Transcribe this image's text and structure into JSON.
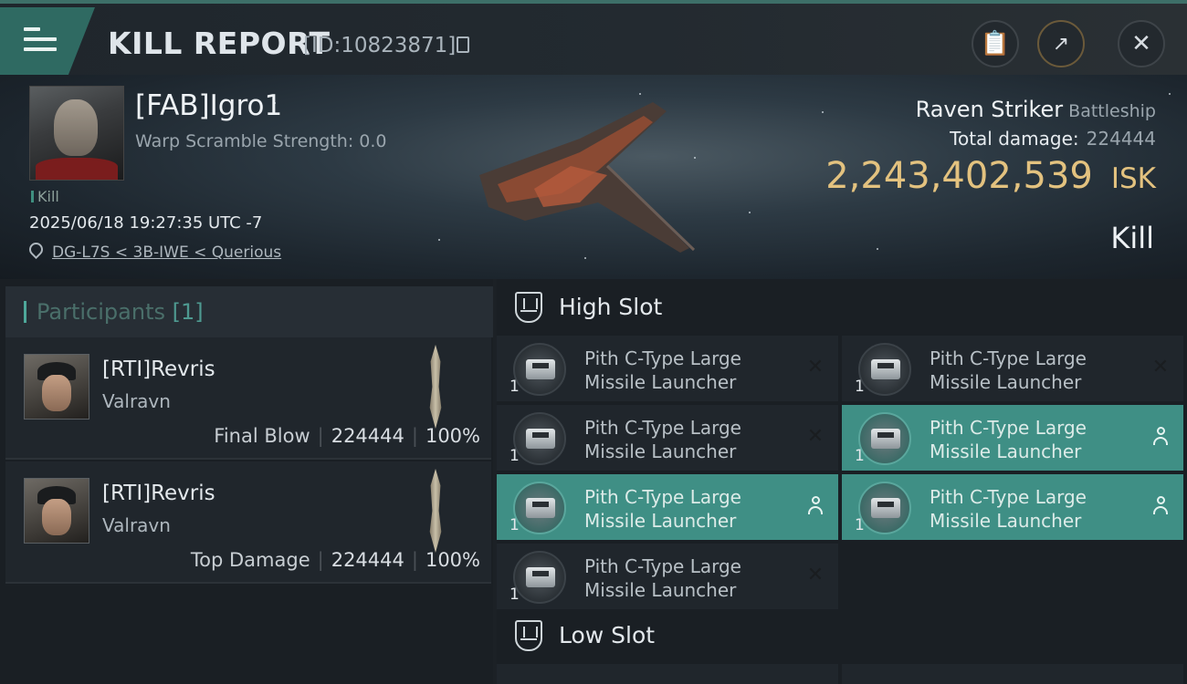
{
  "header": {
    "title": "KILL REPORT",
    "report_id": "[ID:10823871]",
    "menu_icon": "hamburger-menu-icon",
    "buttons": [
      "clipboard-icon",
      "share-icon",
      "close-icon"
    ]
  },
  "victim": {
    "name": "[FAB]Igro1",
    "warp_scramble": "Warp Scramble Strength: 0.0",
    "tag": "Kill",
    "datetime": "2025/06/18 19:27:35 UTC -7",
    "location": "DG-L7S < 3B-IWE < Querious",
    "ship_name": "Raven Striker",
    "ship_class": "Battleship",
    "total_damage_label": "Total damage:",
    "total_damage": "224444",
    "isk_value": "2,243,402,539",
    "isk_unit": "ISK",
    "result": "Kill"
  },
  "participants": {
    "title": "Participants",
    "count": "[1]",
    "items": [
      {
        "name": "[RTI]Revris",
        "ship": "Valravn",
        "label": "Final Blow",
        "damage": "224444",
        "percent": "100%"
      },
      {
        "name": "[RTI]Revris",
        "ship": "Valravn",
        "label": "Top Damage",
        "damage": "224444",
        "percent": "100%"
      }
    ]
  },
  "high_slot": {
    "title": "High Slot",
    "modules": [
      {
        "line1": "Pith C-Type Large",
        "line2": "Missile Launcher",
        "qty": "1",
        "status": "destroyed"
      },
      {
        "line1": "Pith C-Type Large",
        "line2": "Missile Launcher",
        "qty": "1",
        "status": "destroyed"
      },
      {
        "line1": "Pith C-Type Large",
        "line2": "Missile Launcher",
        "qty": "1",
        "status": "destroyed"
      },
      {
        "line1": "Pith C-Type Large",
        "line2": "Missile Launcher",
        "qty": "1",
        "status": "dropped"
      },
      {
        "line1": "Pith C-Type Large",
        "line2": "Missile Launcher",
        "qty": "1",
        "status": "dropped"
      },
      {
        "line1": "Pith C-Type Large",
        "line2": "Missile Launcher",
        "qty": "1",
        "status": "dropped"
      },
      {
        "line1": "Pith C-Type Large",
        "line2": "Missile Launcher",
        "qty": "1",
        "status": "destroyed"
      }
    ]
  },
  "low_slot": {
    "title": "Low Slot"
  },
  "colors": {
    "accent": "#3f8f85",
    "isk_gold": "#e3c27f",
    "panel": "#20262c"
  }
}
